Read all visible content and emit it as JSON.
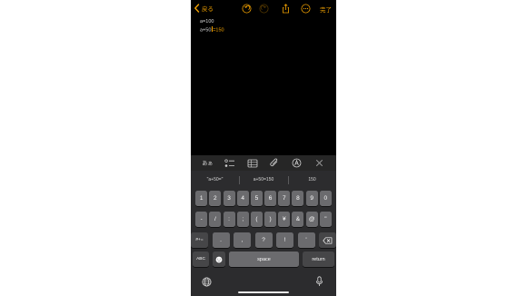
{
  "nav": {
    "back_label": "戻る",
    "done_label": "完了"
  },
  "note": {
    "line1": "a=100",
    "line2_expr": "a+50",
    "line2_result": "=150"
  },
  "toolbar": {
    "kana_label": "あぁ"
  },
  "suggestions": [
    "\"a+50=\"",
    "a+50=150",
    "150"
  ],
  "keyboard": {
    "row1": [
      "1",
      "2",
      "3",
      "4",
      "5",
      "6",
      "7",
      "8",
      "9",
      "0"
    ],
    "row2": [
      "-",
      "/",
      ":",
      ";",
      "(",
      ")",
      "¥",
      "&",
      "@",
      "\""
    ],
    "row3_left": "#+=",
    "row3": [
      ".",
      ",",
      "?",
      "!",
      "'"
    ],
    "abc_label": "ABC",
    "space_label": "space",
    "return_label": "return"
  },
  "colors": {
    "accent": "#f0a000",
    "keyboard_bg": "#2c2c2e",
    "key_bg": "#6b6b6e",
    "dark_key_bg": "#464648"
  }
}
